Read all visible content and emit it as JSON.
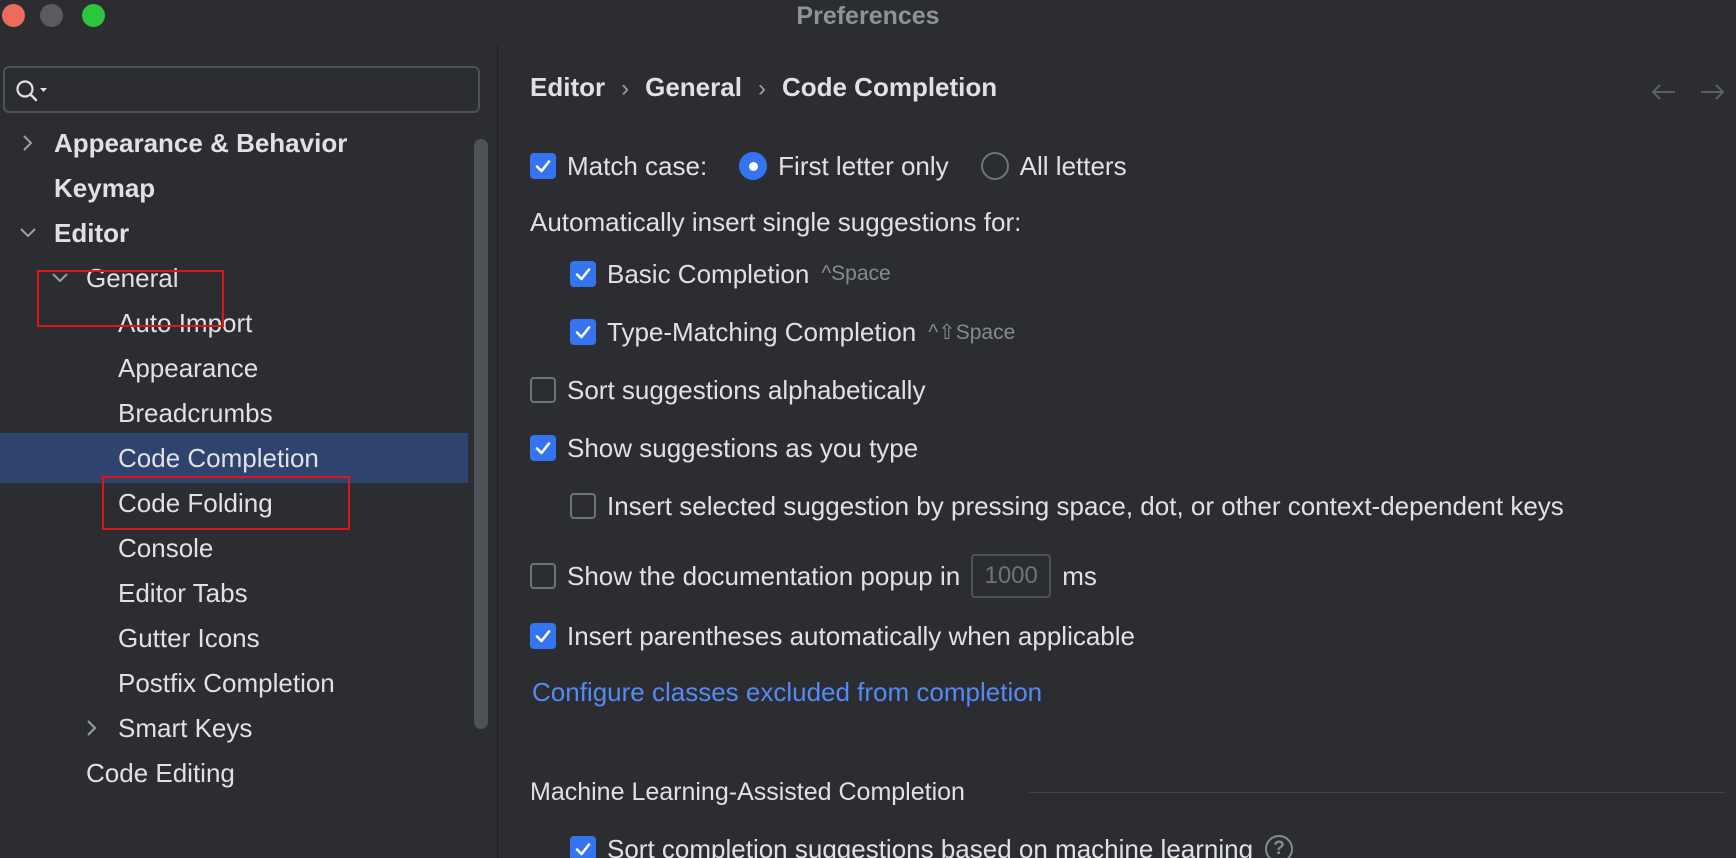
{
  "window": {
    "title": "Preferences"
  },
  "search": {
    "value": "",
    "placeholder": ""
  },
  "sidebar": {
    "items": [
      {
        "label": "Appearance & Behavior"
      },
      {
        "label": "Keymap"
      },
      {
        "label": "Editor"
      },
      {
        "label": "General"
      },
      {
        "label": "Auto Import"
      },
      {
        "label": "Appearance"
      },
      {
        "label": "Breadcrumbs"
      },
      {
        "label": "Code Completion"
      },
      {
        "label": "Code Folding"
      },
      {
        "label": "Console"
      },
      {
        "label": "Editor Tabs"
      },
      {
        "label": "Gutter Icons"
      },
      {
        "label": "Postfix Completion"
      },
      {
        "label": "Smart Keys"
      },
      {
        "label": "Code Editing"
      }
    ]
  },
  "breadcrumb": {
    "items": [
      "Editor",
      "General",
      "Code Completion"
    ],
    "separator": "›"
  },
  "settings": {
    "match_case": {
      "label": "Match case:",
      "checked": true
    },
    "radio_first": {
      "label": "First letter only",
      "selected": true
    },
    "radio_all": {
      "label": "All letters",
      "selected": false
    },
    "auto_insert_heading": "Automatically insert single suggestions for:",
    "basic": {
      "label": "Basic Completion",
      "shortcut": "^Space",
      "checked": true
    },
    "type_matching": {
      "label": "Type-Matching Completion",
      "shortcut": "^⇧Space",
      "checked": true
    },
    "sort_alpha": {
      "label": "Sort suggestions alphabetically",
      "checked": false
    },
    "show_as_type": {
      "label": "Show suggestions as you type",
      "checked": true
    },
    "insert_selected": {
      "label": "Insert selected suggestion by pressing space, dot, or other context-dependent keys",
      "checked": false
    },
    "doc_popup": {
      "label": "Show the documentation popup in",
      "value": "1000",
      "unit": "ms",
      "checked": false
    },
    "insert_parens": {
      "label": "Insert parentheses automatically when applicable",
      "checked": true
    },
    "configure_link": "Configure classes excluded from completion",
    "ml_section": "Machine Learning-Assisted Completion",
    "ml_sort": {
      "label": "Sort completion suggestions based on machine learning",
      "checked": true,
      "help": "?"
    }
  },
  "colors": {
    "accent": "#3574f0",
    "link": "#548af7",
    "selection": "#2e436e",
    "highlight": "#e0141b"
  }
}
